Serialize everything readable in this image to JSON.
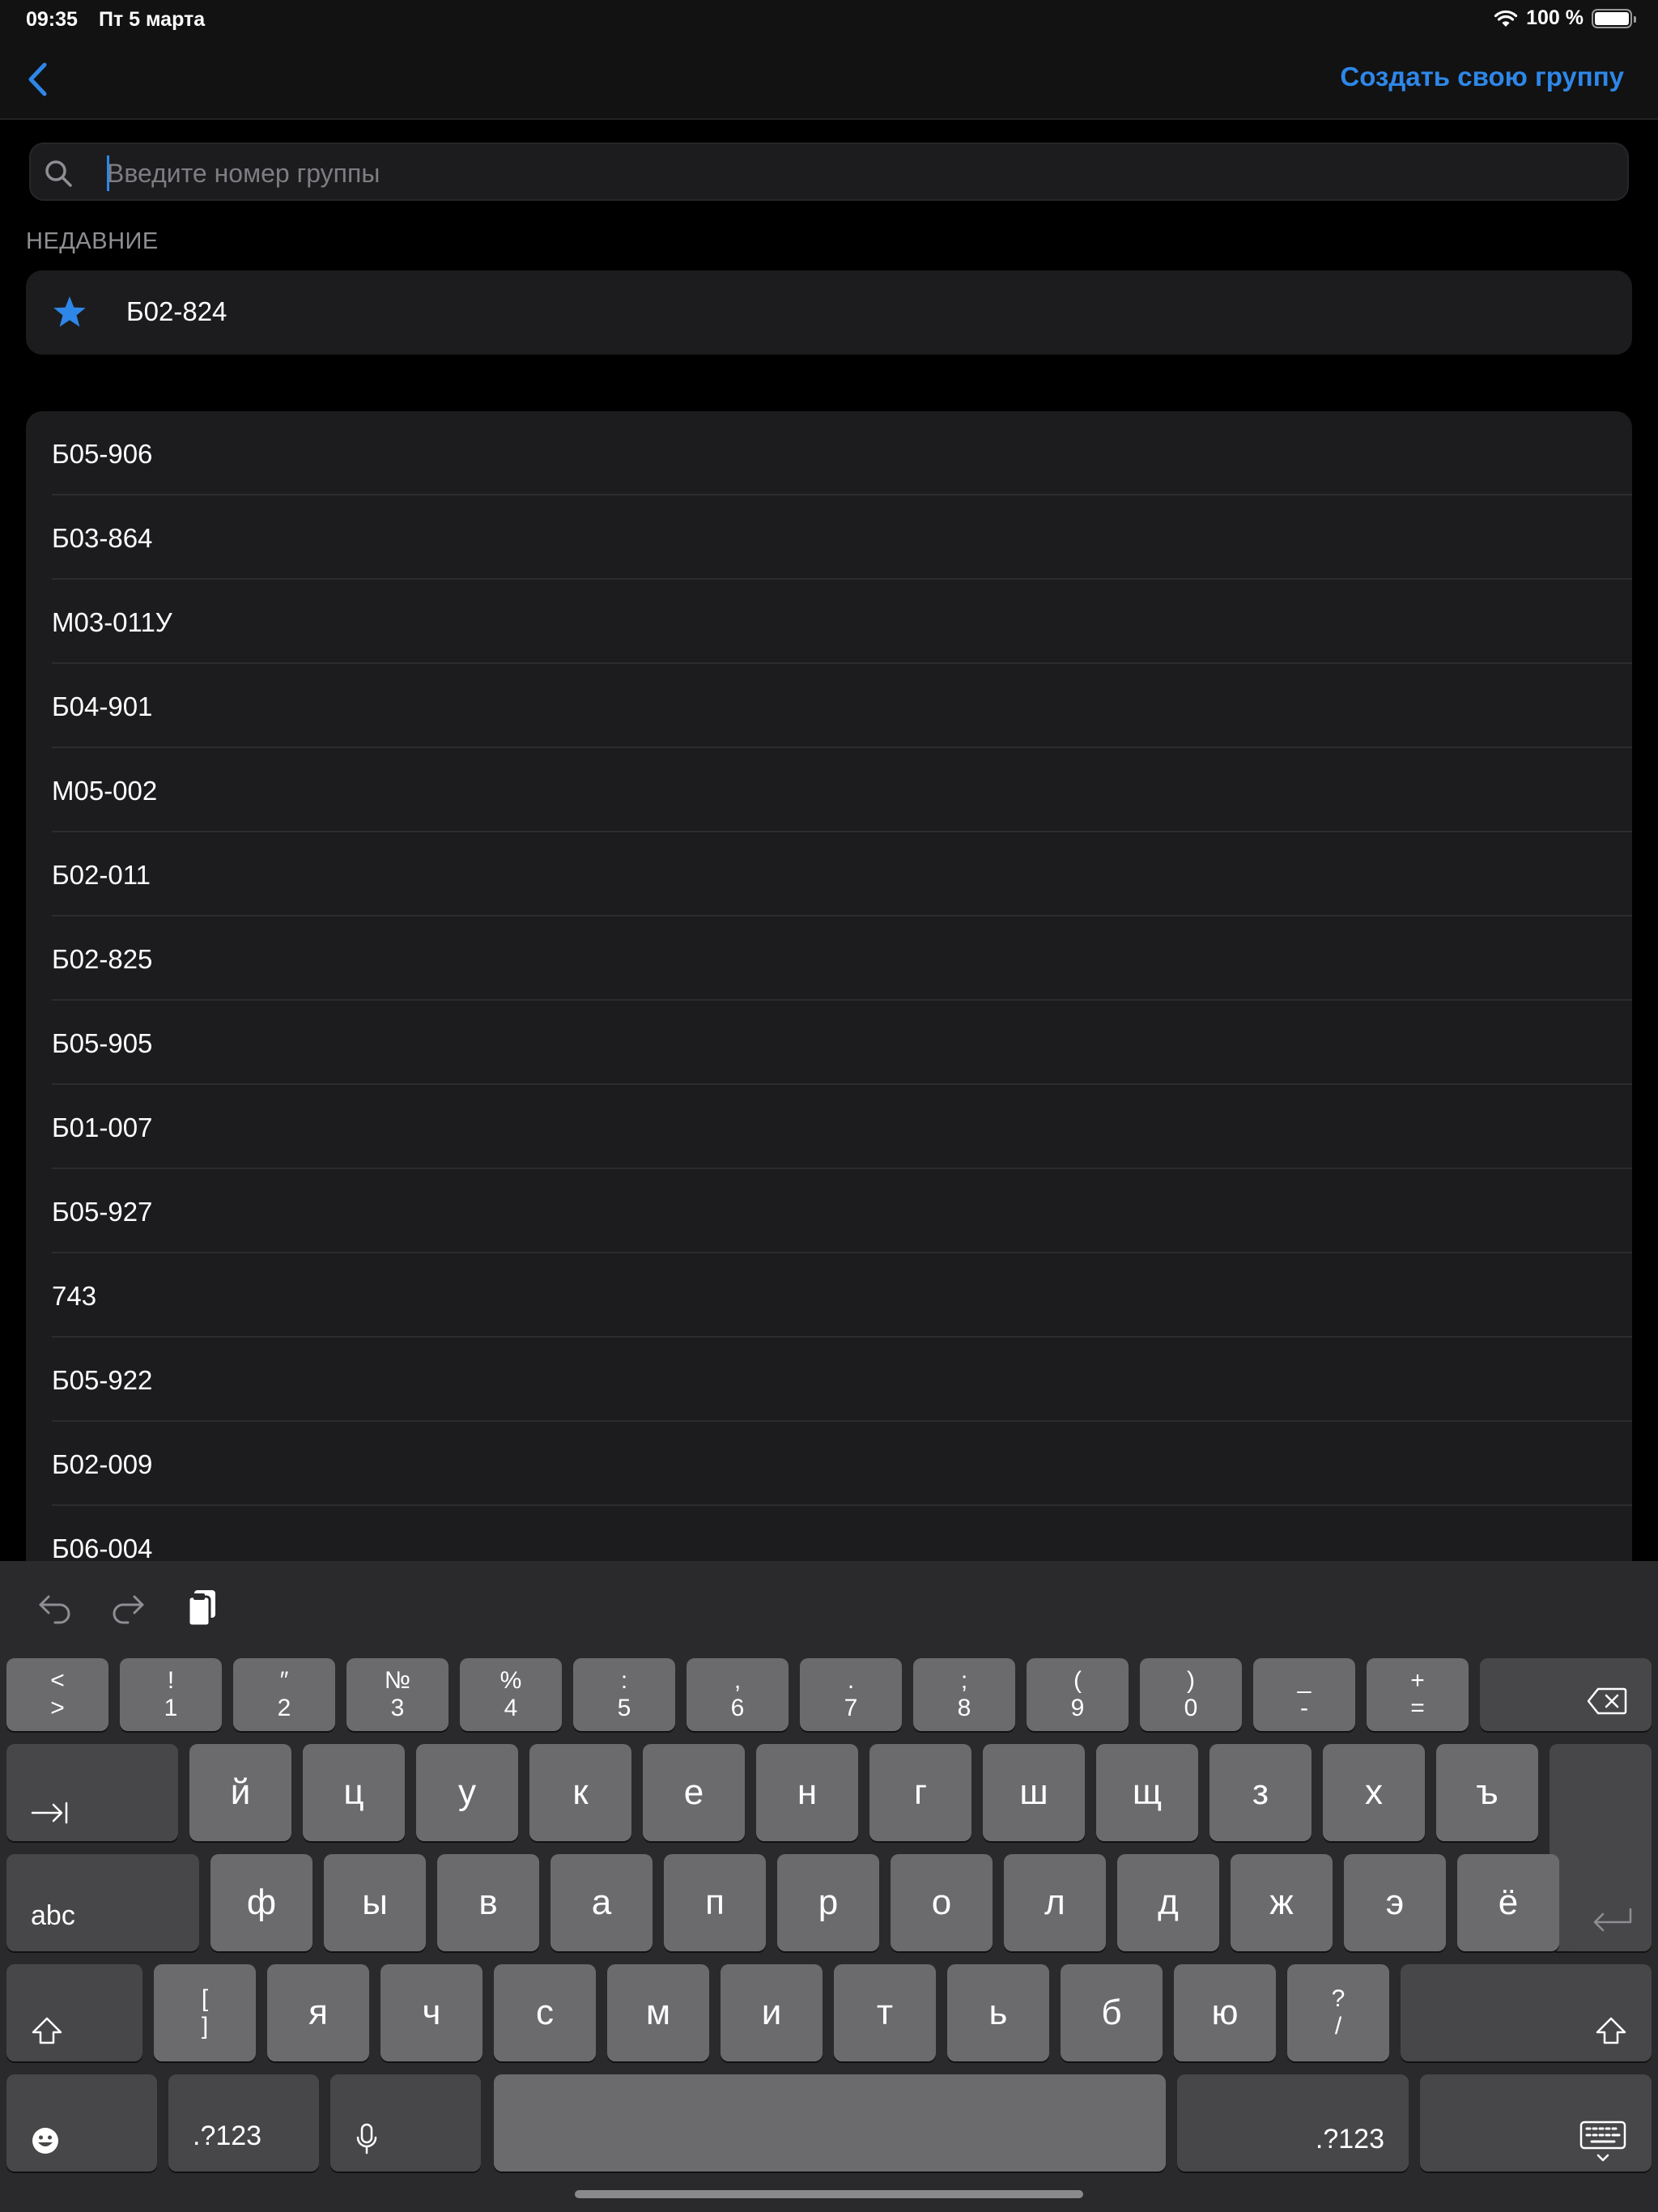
{
  "status_bar": {
    "time": "09:35",
    "date": "Пт 5 марта",
    "battery": "100 %"
  },
  "nav": {
    "create_group_label": "Создать свою группу"
  },
  "search": {
    "placeholder": "Введите номер группы",
    "value": ""
  },
  "recent": {
    "header": "НЕДАВНИЕ",
    "item": "Б02-824"
  },
  "groups": [
    "Б05-906",
    "Б03-864",
    "М03-011У",
    "Б04-901",
    "М05-002",
    "Б02-011",
    "Б02-825",
    "Б05-905",
    "Б01-007",
    "Б05-927",
    "743",
    "Б05-922",
    "Б02-009",
    "Б06-004"
  ],
  "keyboard": {
    "row1": [
      {
        "top": "<",
        "bottom": ">"
      },
      {
        "top": "!",
        "bottom": "1"
      },
      {
        "top": "″",
        "bottom": "2"
      },
      {
        "top": "№",
        "bottom": "3"
      },
      {
        "top": "%",
        "bottom": "4"
      },
      {
        "top": ":",
        "bottom": "5"
      },
      {
        "top": ",",
        "bottom": "6"
      },
      {
        "top": ".",
        "bottom": "7"
      },
      {
        "top": ";",
        "bottom": "8"
      },
      {
        "top": "(",
        "bottom": "9"
      },
      {
        "top": ")",
        "bottom": "0"
      },
      {
        "top": "_",
        "bottom": "-"
      },
      {
        "top": "+",
        "bottom": "="
      }
    ],
    "row2": [
      "й",
      "ц",
      "у",
      "к",
      "е",
      "н",
      "г",
      "ш",
      "щ",
      "з",
      "х",
      "ъ"
    ],
    "row3": [
      "ф",
      "ы",
      "в",
      "а",
      "п",
      "р",
      "о",
      "л",
      "д",
      "ж",
      "э",
      "ё"
    ],
    "row4": [
      {
        "top": "[",
        "bottom": "]"
      },
      "я",
      "ч",
      "с",
      "м",
      "и",
      "т",
      "ь",
      "б",
      "ю",
      {
        "top": "?",
        "bottom": "/"
      }
    ],
    "abc_label": "abc",
    "numbers_label": ".?123"
  }
}
